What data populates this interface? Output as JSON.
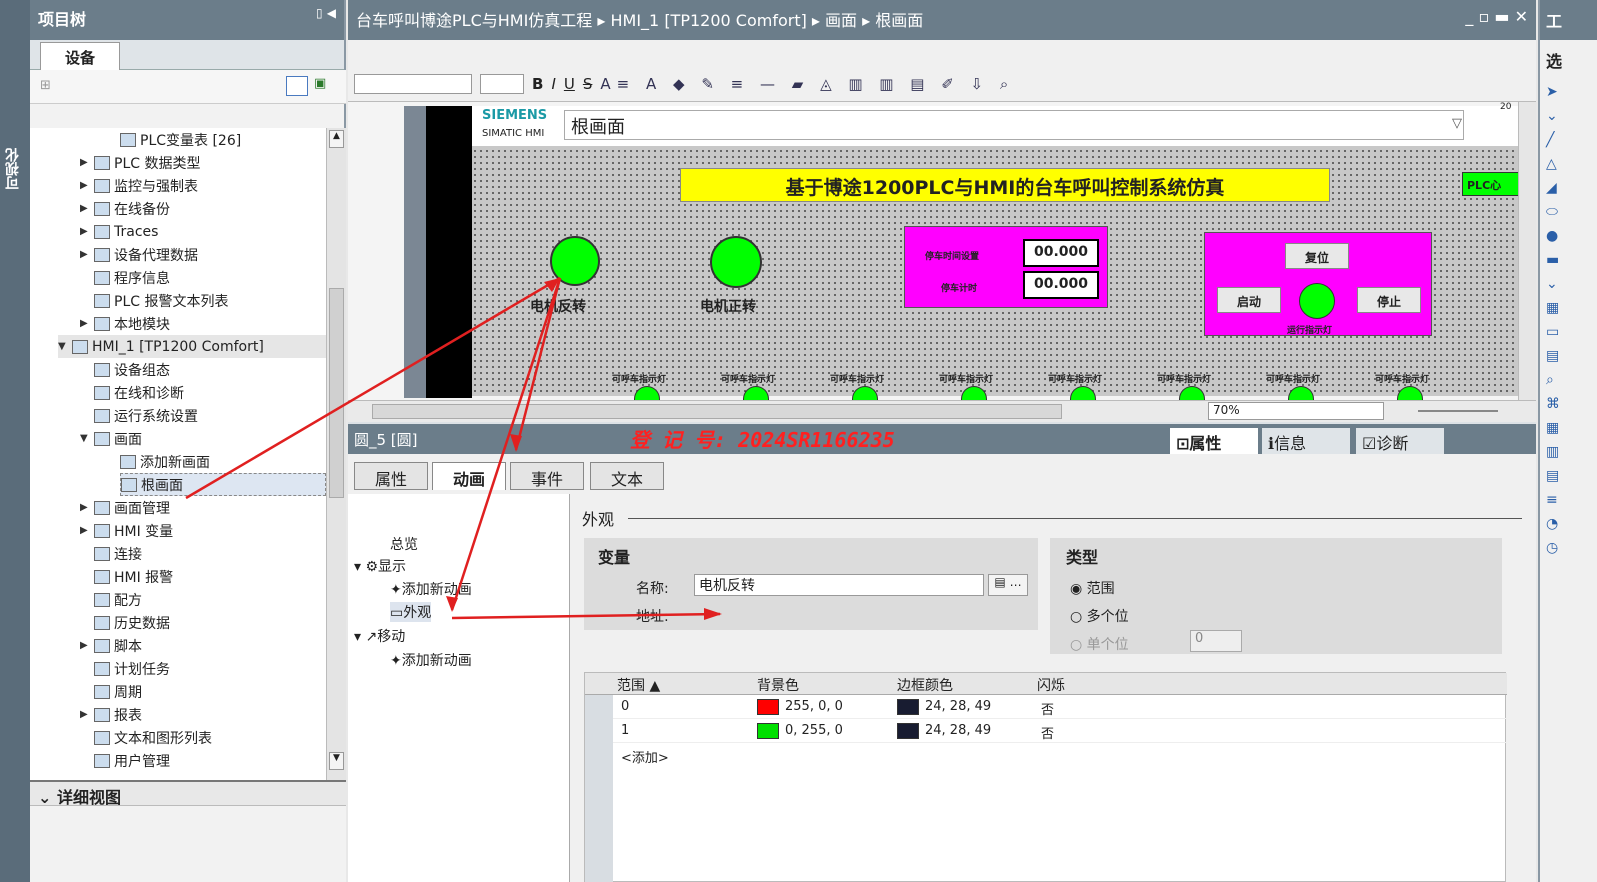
{
  "vtab": {
    "label": "可视化"
  },
  "project": {
    "title": "项目树",
    "tab": "设备",
    "items": [
      {
        "label": "PLC变量表 [26]",
        "indent": 90,
        "arrow": false
      },
      {
        "label": "PLC 数据类型",
        "indent": 50,
        "arrow": true
      },
      {
        "label": "监控与强制表",
        "indent": 50,
        "arrow": true
      },
      {
        "label": "在线备份",
        "indent": 50,
        "arrow": true
      },
      {
        "label": "Traces",
        "indent": 50,
        "arrow": true
      },
      {
        "label": "设备代理数据",
        "indent": 50,
        "arrow": true
      },
      {
        "label": "程序信息",
        "indent": 64,
        "arrow": false
      },
      {
        "label": "PLC 报警文本列表",
        "indent": 64,
        "arrow": false
      },
      {
        "label": "本地模块",
        "indent": 50,
        "arrow": true
      },
      {
        "label": "HMI_1 [TP1200 Comfort]",
        "indent": 28,
        "arrow": true
      },
      {
        "label": "设备组态",
        "indent": 64,
        "arrow": false
      },
      {
        "label": "在线和诊断",
        "indent": 64,
        "arrow": false
      },
      {
        "label": "运行系统设置",
        "indent": 64,
        "arrow": false
      },
      {
        "label": "画面",
        "indent": 50,
        "arrow": true
      },
      {
        "label": "添加新画面",
        "indent": 90,
        "arrow": false
      },
      {
        "label": "根画面",
        "indent": 90,
        "arrow": false
      },
      {
        "label": "画面管理",
        "indent": 50,
        "arrow": true
      },
      {
        "label": "HMI 变量",
        "indent": 50,
        "arrow": true
      },
      {
        "label": "连接",
        "indent": 64,
        "arrow": false
      },
      {
        "label": "HMI 报警",
        "indent": 64,
        "arrow": false
      },
      {
        "label": "配方",
        "indent": 64,
        "arrow": false
      },
      {
        "label": "历史数据",
        "indent": 64,
        "arrow": false
      },
      {
        "label": "脚本",
        "indent": 50,
        "arrow": true
      },
      {
        "label": "计划任务",
        "indent": 64,
        "arrow": false
      },
      {
        "label": "周期",
        "indent": 64,
        "arrow": false
      },
      {
        "label": "报表",
        "indent": 50,
        "arrow": true
      },
      {
        "label": "文本和图形列表",
        "indent": 64,
        "arrow": false
      },
      {
        "label": "用户管理",
        "indent": 64,
        "arrow": false
      }
    ],
    "detail_title": "详细视图"
  },
  "breadcrumb": "台车呼叫博途PLC与HMI仿真工程 ▸ HMI_1 [TP1200 Comfort] ▸ 画面 ▸ 根画面",
  "toolbar": {
    "b": "B",
    "i": "I",
    "u": "U",
    "s": "S"
  },
  "hmi": {
    "brand": "SIEMENS",
    "sub": "SIMATIC HMI",
    "screen": "根画面",
    "title": "基于博途1200PLC与HMI的台车呼叫控制系统仿真",
    "plc": "PLC心",
    "motor_rev": "电机反转",
    "motor_fwd": "电机正转",
    "stop_time_set": "停车时间设置",
    "stop_time": "停车计时",
    "val1": "00.000",
    "val2": "00.000",
    "reset": "复位",
    "start": "启动",
    "stop": "停止",
    "run_light": "运行指示灯",
    "call_light": "可呼车指示灯",
    "zoom": "70%",
    "corner": "20"
  },
  "props": {
    "obj": "圆_5 [圆]",
    "watermark": "登 记 号: 2024SR1166235",
    "tab_prop": "属性",
    "tab_info": "信息",
    "tab_diag": "诊断",
    "tabs": [
      "属性",
      "动画",
      "事件",
      "文本"
    ],
    "nav": {
      "overview": "总览",
      "display": "显示",
      "add_anim": "添加新动画",
      "appearance": "外观",
      "move": "移动",
      "add_anim2": "添加新动画"
    },
    "section": "外观",
    "var_title": "变量",
    "name_label": "名称:",
    "name_value": "电机反转",
    "addr_label": "地址:",
    "type_title": "类型",
    "r1": "范围",
    "r2": "多个位",
    "r3": "单个位",
    "spin": "0",
    "cols": [
      "范围 ▲",
      "背景色",
      "边框颜色",
      "闪烁"
    ],
    "rows": [
      {
        "range": "0",
        "bg": "255, 0, 0",
        "bgc": "#ff0000",
        "border": "24, 28, 49",
        "flash": "否"
      },
      {
        "range": "1",
        "bg": "0, 255, 0",
        "bgc": "#00e000",
        "border": "24, 28, 49",
        "flash": "否"
      }
    ],
    "add": "<添加>"
  },
  "right": {
    "t1": "工",
    "t2": "选"
  }
}
